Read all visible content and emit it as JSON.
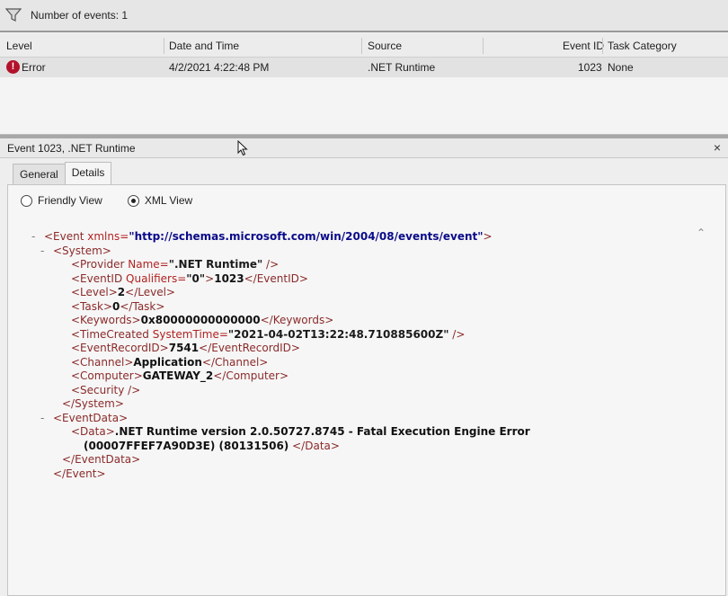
{
  "filter": {
    "count_label": "Number of events: 1",
    "icon": "funnel-icon"
  },
  "grid": {
    "columns": [
      "Level",
      "Date and Time",
      "Source",
      "Event ID",
      "Task Category"
    ],
    "rows": [
      {
        "level": "Error",
        "date": "4/2/2021 4:22:48 PM",
        "source": ".NET Runtime",
        "event_id": "1023",
        "task": "None"
      }
    ]
  },
  "detail": {
    "title": "Event 1023, .NET Runtime",
    "close": "×",
    "tabs": [
      "General",
      "Details"
    ],
    "view_options": [
      "Friendly View",
      "XML View"
    ],
    "selected_view": "XML View"
  },
  "xml": {
    "event_open_tag": "<Event",
    "xmlns_attr": "xmlns=",
    "xmlns_value": "\"http://schemas.microsoft.com/win/2004/08/events/event\"",
    "event_open_end": ">",
    "system_open": "<System>",
    "provider_tag": "<Provider",
    "provider_attr": " Name=",
    "provider_value": "\".NET Runtime\"",
    "provider_end": " />",
    "eventid_tag": "<EventID",
    "eventid_attr": " Qualifiers=",
    "eventid_attr_value": "\"0\"",
    "eventid_gt": ">",
    "eventid_value": "1023",
    "eventid_close": "</EventID>",
    "level_open": "<Level>",
    "level_value": "2",
    "level_close": "</Level>",
    "task_open": "<Task>",
    "task_value": "0",
    "task_close": "</Task>",
    "keywords_open": "<Keywords>",
    "keywords_value": "0x80000000000000",
    "keywords_close": "</Keywords>",
    "timecreated_tag": "<TimeCreated",
    "timecreated_attr": " SystemTime=",
    "timecreated_value": "\"2021-04-02T13:22:48.710885600Z\"",
    "timecreated_end": " />",
    "recordid_open": "<EventRecordID>",
    "recordid_value": "7541",
    "recordid_close": "</EventRecordID>",
    "channel_open": "<Channel>",
    "channel_value": "Application",
    "channel_close": "</Channel>",
    "computer_open": "<Computer>",
    "computer_value": "GATEWAY_2",
    "computer_close": "</Computer>",
    "security": "<Security />",
    "system_close": "</System>",
    "eventdata_open": "<EventData>",
    "data_open": "<Data>",
    "data_value_line1": ".NET Runtime version 2.0.50727.8745 - Fatal Execution Engine Error",
    "data_value_line2": "(00007FFEF7A90D3E) (80131506)",
    "data_close": "</Data>",
    "eventdata_close": "</EventData>",
    "event_close": "</Event>",
    "collapse_glyph": "-"
  }
}
